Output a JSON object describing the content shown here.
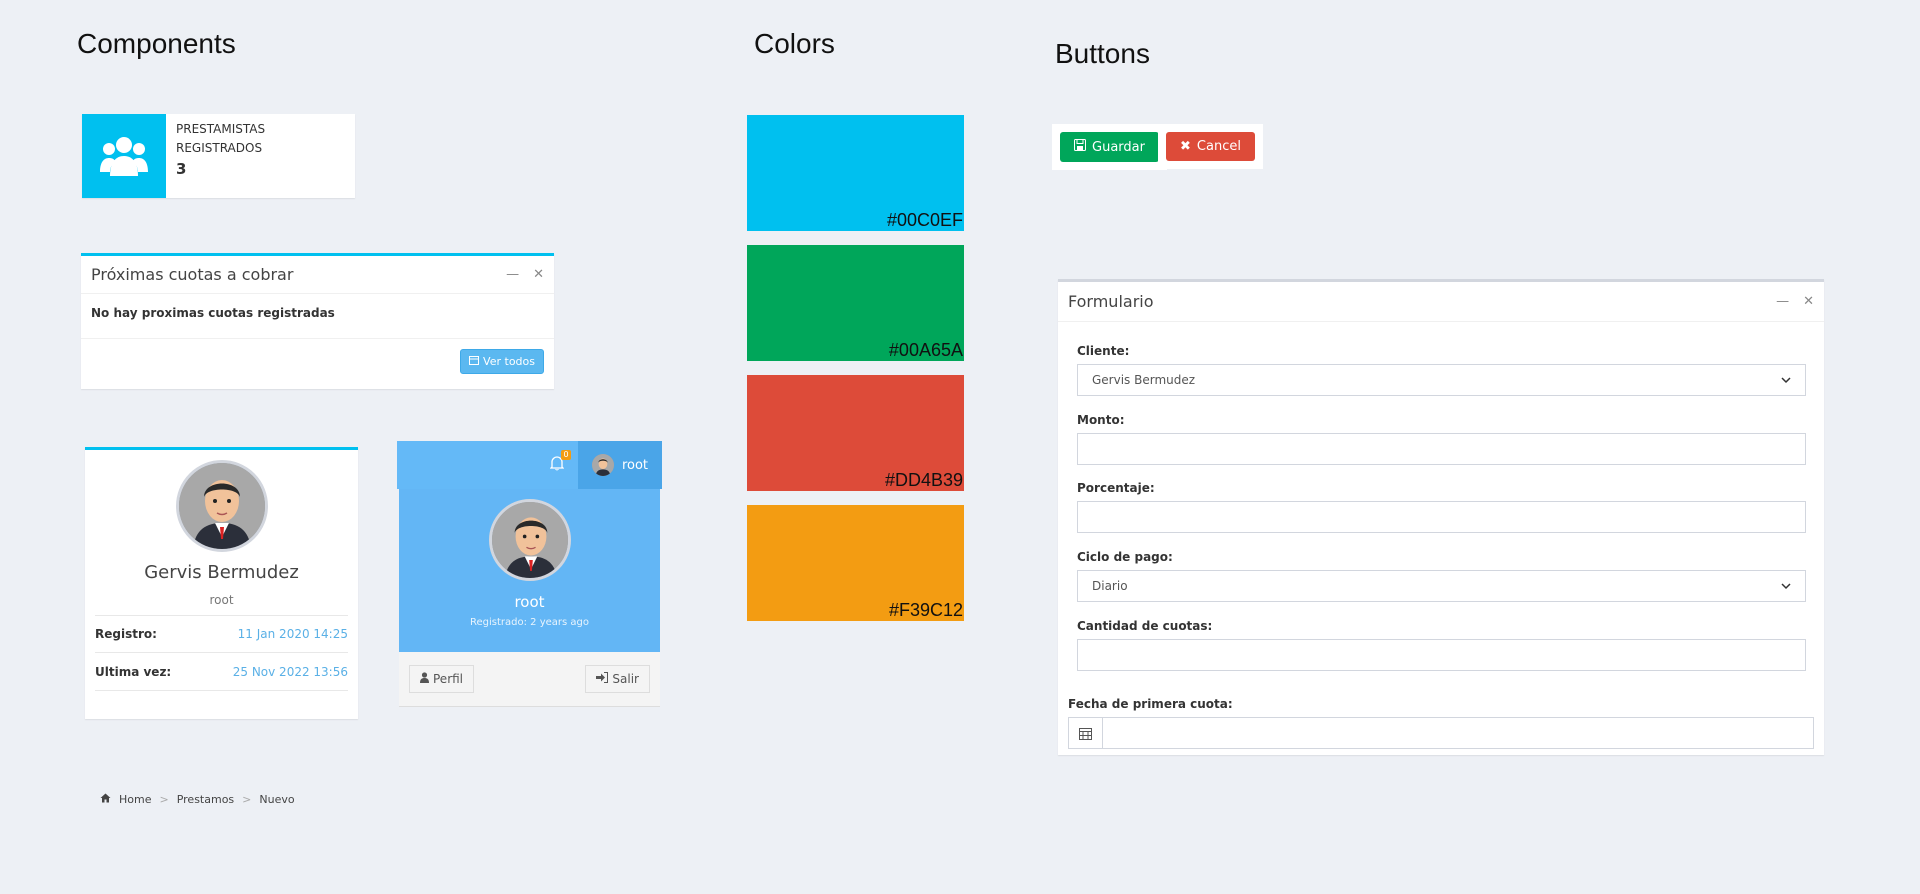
{
  "sections": {
    "components": "Components",
    "colors": "Colors",
    "buttons": "Buttons"
  },
  "info_box": {
    "icon": "users-icon",
    "label_line1": "PRESTAMISTAS",
    "label_line2": "REGISTRADOS",
    "number": "3",
    "color": "#00c0ef"
  },
  "cuotas_box": {
    "title": "Próximas cuotas a cobrar",
    "message": "No hay proximas cuotas registradas",
    "button_label": "Ver todos"
  },
  "profile_card": {
    "name": "Gervis Bermudez",
    "role": "root",
    "rows": [
      {
        "label": "Registro:",
        "value": "11 Jan 2020 14:25"
      },
      {
        "label": "Ultima vez:",
        "value": "25 Nov 2022 13:56"
      }
    ]
  },
  "user_menu": {
    "notification_count": "0",
    "username": "root",
    "body_name": "root",
    "registered": "Registrado: 2 years ago",
    "profile_button": "Perfil",
    "logout_button": "Salir"
  },
  "colors": [
    {
      "hex": "#00C0EF",
      "label": "#00C0EF"
    },
    {
      "hex": "#00A65A",
      "label": "#00A65A"
    },
    {
      "hex": "#DD4B39",
      "label": "#DD4B39"
    },
    {
      "hex": "#F39C12",
      "label": "#F39C12"
    }
  ],
  "buttons": {
    "save": "Guardar",
    "cancel": "Cancel"
  },
  "form": {
    "title": "Formulario",
    "cliente_label": "Cliente:",
    "cliente_value": "Gervis Bermudez",
    "monto_label": "Monto:",
    "porcentaje_label": "Porcentaje:",
    "ciclo_label": "Ciclo de pago:",
    "ciclo_value": "Diario",
    "cantidad_label": "Cantidad de cuotas:",
    "fecha_label": "Fecha de primera cuota:"
  },
  "breadcrumb": {
    "items": [
      "Home",
      "Prestamos",
      "Nuevo"
    ],
    "separator": ">"
  }
}
